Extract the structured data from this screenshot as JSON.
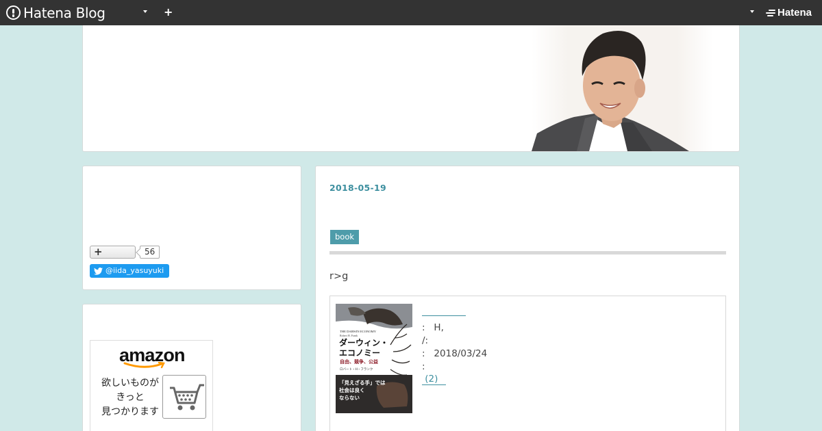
{
  "navbar": {
    "brand": "Hatena Blog",
    "add_icon": "plus-icon",
    "account_logo": "Hatena"
  },
  "sidebar": {
    "hatebu_count": "56",
    "twitter_handle": "@iida_yasuyuki",
    "amazon": {
      "logo": "amazon",
      "line1": "欲しいものが",
      "line2": "きっと",
      "line3": "見つかります"
    }
  },
  "entry": {
    "date": "2018-05-19",
    "category": "book",
    "body": "r>g",
    "book": {
      "cover_title_en": "THE DARWIN ECONOMY",
      "cover_author_en": "Robert H. Frank",
      "cover_title_1": "ダーウィン・",
      "cover_title_2": "エコノミー",
      "cover_subtitle": "自由、競争、公益",
      "cover_author": "ロバート・H・フランク",
      "cover_band_1": "「見えざる手」では",
      "cover_band_2": "社会は良く",
      "cover_band_3": "ならない",
      "author_row": ":   H,",
      "publisher_row": "/:",
      "date_row": ":   2018/03/24",
      "blank_row": ":",
      "review_link": " (2)"
    }
  },
  "colors": {
    "background": "#d0e9e8",
    "navbar": "#333333",
    "accent": "#3d8f9f",
    "tag": "#4e9caa",
    "twitter": "#1d9bf0"
  }
}
